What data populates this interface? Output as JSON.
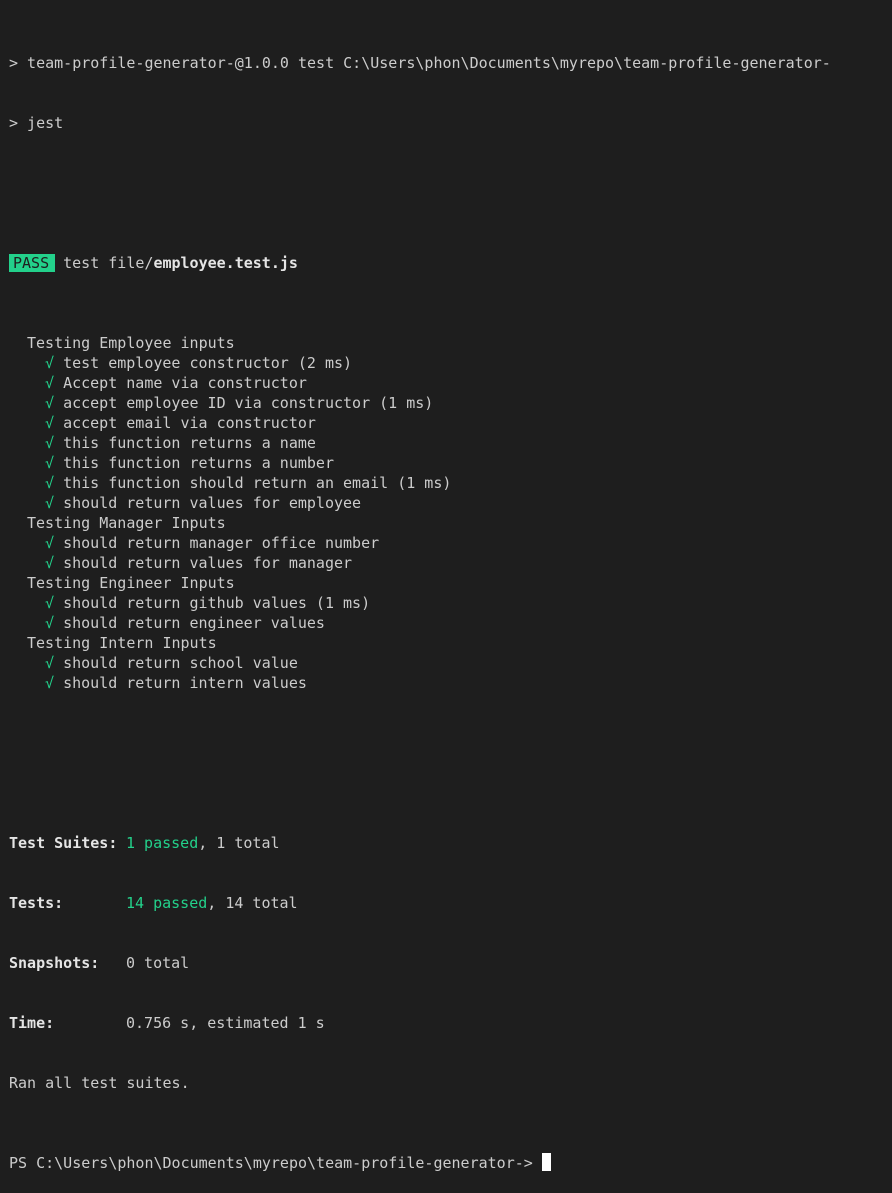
{
  "header": {
    "line1": "> team-profile-generator-@1.0.0 test C:\\Users\\phon\\Documents\\myrepo\\team-profile-generator-",
    "line2": "> jest"
  },
  "result": {
    "badge": "PASS",
    "prefix": "test file/",
    "file": "employee.test.js"
  },
  "check_glyph": "√",
  "groups": [
    {
      "title": "Testing Employee inputs",
      "tests": [
        "test employee constructor (2 ms)",
        "Accept name via constructor",
        "accept employee ID via constructor (1 ms)",
        "accept email via constructor",
        "this function returns a name",
        "this function returns a number",
        "this function should return an email (1 ms)",
        "should return values for employee"
      ]
    },
    {
      "title": "Testing Manager Inputs",
      "tests": [
        "should return manager office number",
        "should return values for manager"
      ]
    },
    {
      "title": "Testing Engineer Inputs",
      "tests": [
        "should return github values (1 ms)",
        "should return engineer values"
      ]
    },
    {
      "title": "Testing Intern Inputs",
      "tests": [
        "should return school value",
        "should return intern values"
      ]
    }
  ],
  "summary": {
    "suites_label": "Test Suites:",
    "suites_passed": "1 passed",
    "suites_total": ", 1 total",
    "tests_label": "Tests:",
    "tests_passed": "14 passed",
    "tests_total": ", 14 total",
    "snapshots_label": "Snapshots:",
    "snapshots_value": "0 total",
    "time_label": "Time:",
    "time_value": "0.756 s, estimated 1 s",
    "ran": "Ran all test suites."
  },
  "prompt": {
    "text": "PS C:\\Users\\phon\\Documents\\myrepo\\team-profile-generator-> "
  },
  "colors": {
    "background": "#1e1e1e",
    "text": "#cccccc",
    "pass_green": "#23d18b"
  }
}
